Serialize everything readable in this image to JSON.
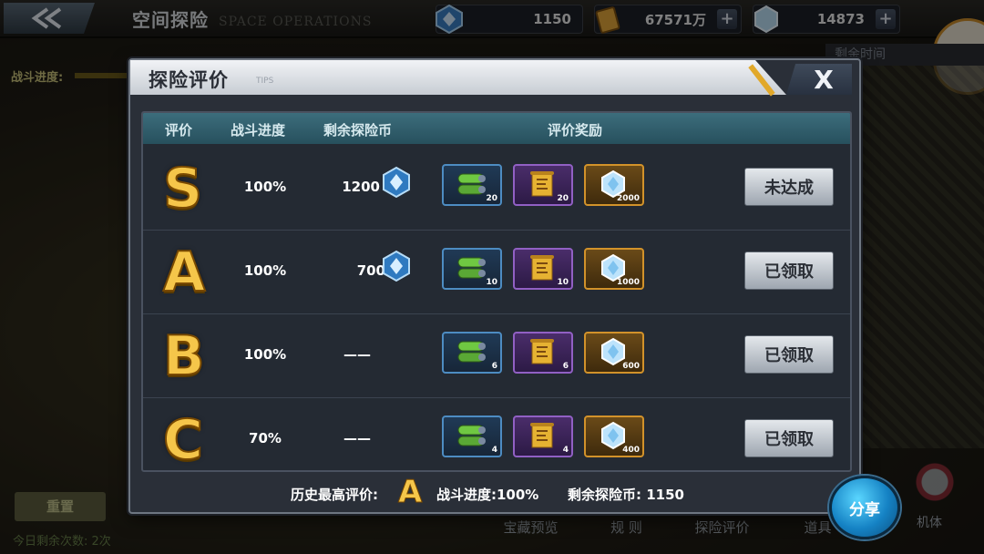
{
  "hud": {
    "page_title": "空间探险",
    "page_subtitle": "SPACE OPERATIONS",
    "currencies": [
      {
        "name": "explore-coin",
        "value": "1150"
      },
      {
        "name": "gold",
        "value": "67571万"
      },
      {
        "name": "crystal",
        "value": "14873"
      }
    ],
    "battle_progress_label": "战斗进度:",
    "remain_time_label": "剩余时间",
    "reset_button": "重置",
    "remaining_count": "今日剩余次数: 2次",
    "bottom_nav": [
      "宝藏预览",
      "规 则",
      "探险评价",
      "道具"
    ],
    "robot_label": "机体"
  },
  "dialog": {
    "title": "探险评价",
    "tips": "TIPS",
    "close": "X",
    "columns": {
      "grade": "评价",
      "progress": "战斗进度",
      "coins": "剩余探险币",
      "rewards": "评价奖励"
    },
    "rows": [
      {
        "grade": "S",
        "progress": "100%",
        "coins": "1200",
        "has_coin_icon": true,
        "rewards": [
          {
            "type": "fuel",
            "qty": "20"
          },
          {
            "type": "scroll",
            "qty": "20"
          },
          {
            "type": "crystal",
            "qty": "2000"
          }
        ],
        "status": "未达成"
      },
      {
        "grade": "A",
        "progress": "100%",
        "coins": "700",
        "has_coin_icon": true,
        "rewards": [
          {
            "type": "fuel",
            "qty": "10"
          },
          {
            "type": "scroll",
            "qty": "10"
          },
          {
            "type": "crystal",
            "qty": "1000"
          }
        ],
        "status": "已领取"
      },
      {
        "grade": "B",
        "progress": "100%",
        "coins": "——",
        "has_coin_icon": false,
        "rewards": [
          {
            "type": "fuel",
            "qty": "6"
          },
          {
            "type": "scroll",
            "qty": "6"
          },
          {
            "type": "crystal",
            "qty": "600"
          }
        ],
        "status": "已领取"
      },
      {
        "grade": "C",
        "progress": "70%",
        "coins": "——",
        "has_coin_icon": false,
        "rewards": [
          {
            "type": "fuel",
            "qty": "4"
          },
          {
            "type": "scroll",
            "qty": "4"
          },
          {
            "type": "crystal",
            "qty": "400"
          }
        ],
        "status": "已领取"
      }
    ],
    "footer": {
      "best_label": "历史最高评价:",
      "best_grade": "A",
      "progress_text": "战斗进度:100%",
      "coins_text": "剩余探险币: 1150"
    },
    "share_button": "分享"
  },
  "colors": {
    "grade_gold": "#f5c64a",
    "header_teal": "#3c6d7c",
    "button_silver": "#c9cfd6"
  }
}
